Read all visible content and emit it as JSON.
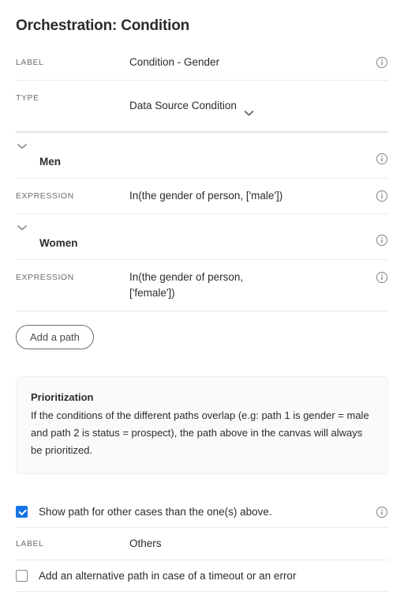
{
  "header": {
    "title": "Orchestration: Condition"
  },
  "colors": {
    "accent": "#1473e6",
    "text": "#2c2c2c",
    "muted": "#6e6e6e",
    "divider": "#eaeaea",
    "callout_bg": "#fafafa"
  },
  "fields": [
    {
      "key": "LABEL",
      "value": "Condition -  Gender",
      "has_info": true,
      "has_caret": false
    },
    {
      "key": "TYPE",
      "value": "Data Source Condition",
      "has_info": false,
      "has_caret": true
    }
  ],
  "paths": [
    {
      "name": "Men",
      "expanded": true,
      "expression_key": "EXPRESSION",
      "expression": "In(the gender of person, ['male'])"
    },
    {
      "name": "Women",
      "expanded": true,
      "expression_key": "EXPRESSION",
      "expression": "In(the gender of person,\n['female'])"
    }
  ],
  "buttons": {
    "add_path": "Add a path"
  },
  "callout": {
    "title": "Prioritization",
    "body": "If the conditions of the different paths overlap (e.g: path 1 is gender = male and path 2 is status = prospect), the path above in the canvas will always be prioritized."
  },
  "options": {
    "show_other_path": {
      "label": "Show path for other cases than the one(s) above.",
      "checked": true,
      "has_info": true
    },
    "others_label": {
      "key": "LABEL",
      "value": "Others"
    },
    "alternative_path": {
      "label": "Add an alternative path in case of a timeout or an error",
      "checked": false,
      "has_info": false
    }
  },
  "icons": {
    "info": "info-circle-icon",
    "chevron_down": "chevron-down-icon",
    "checkmark": "checkmark-icon"
  }
}
